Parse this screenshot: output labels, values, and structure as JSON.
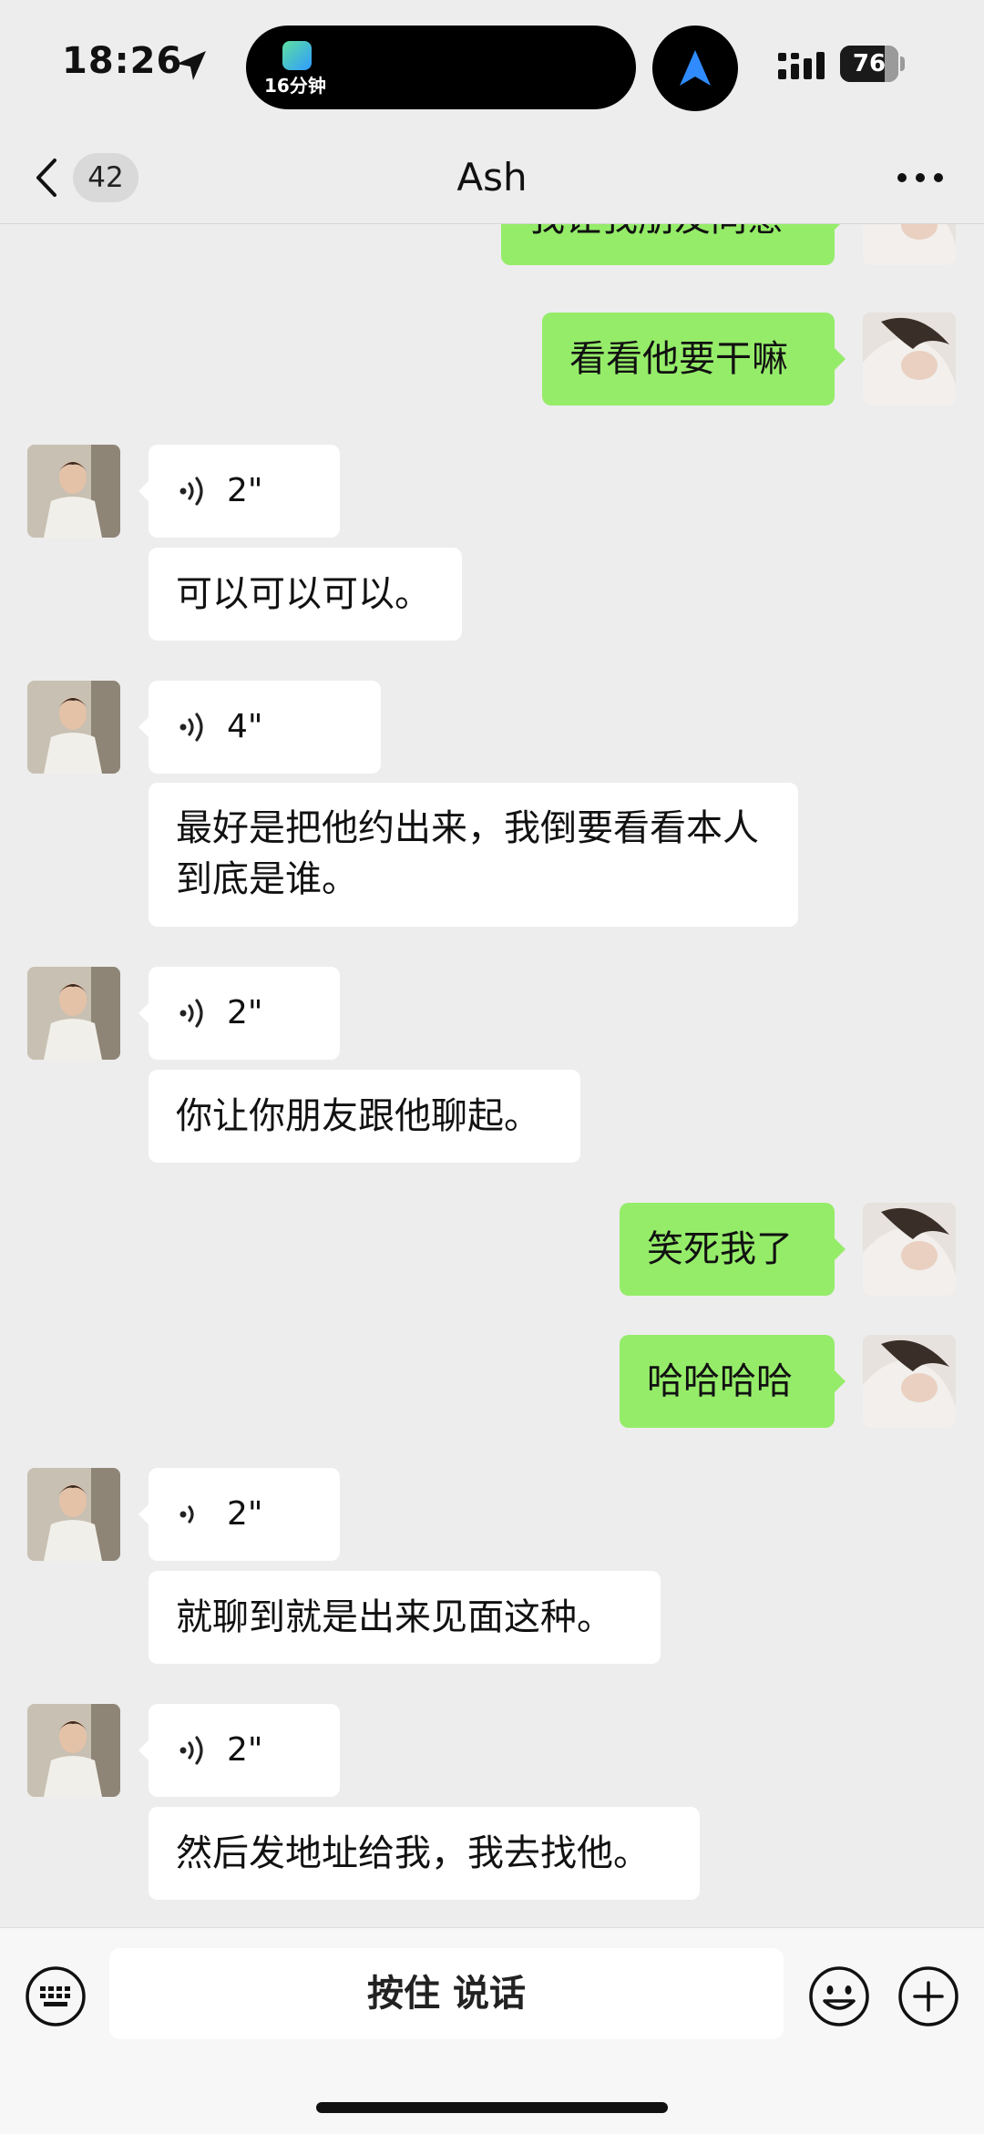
{
  "status_bar": {
    "time": "18:26",
    "island_text": "16分钟",
    "battery": "76",
    "battery_level": 0.76
  },
  "header": {
    "back_badge": "42",
    "title": "Ash"
  },
  "messages": [
    {
      "from": "me",
      "type": "text",
      "text": "我让我朋友同意"
    },
    {
      "from": "me",
      "type": "text",
      "text": "看看他要干嘛"
    },
    {
      "from": "ash",
      "type": "voice",
      "duration": "2\""
    },
    {
      "from": "ash",
      "type": "text",
      "text": "可以可以可以。"
    },
    {
      "from": "ash",
      "type": "voice",
      "duration": "4\""
    },
    {
      "from": "ash",
      "type": "text",
      "text": "最好是把他约出来，我倒要看看本人到底是谁。"
    },
    {
      "from": "ash",
      "type": "voice",
      "duration": "2\""
    },
    {
      "from": "ash",
      "type": "text",
      "text": "你让你朋友跟他聊起。"
    },
    {
      "from": "me",
      "type": "text",
      "text": "笑死我了"
    },
    {
      "from": "me",
      "type": "text",
      "text": "哈哈哈哈"
    },
    {
      "from": "ash",
      "type": "voice",
      "duration": "2\""
    },
    {
      "from": "ash",
      "type": "text",
      "text": "就聊到就是出来见面这种。"
    },
    {
      "from": "ash",
      "type": "voice",
      "duration": "2\""
    },
    {
      "from": "ash",
      "type": "text",
      "text": "然后发地址给我，我去找他。"
    }
  ],
  "input_bar": {
    "hold_to_talk": "按住 说话"
  },
  "colors": {
    "background": "#ededed",
    "outgoing_bubble": "#95ec69",
    "incoming_bubble": "#ffffff"
  },
  "icons": [
    "location-arrow-icon",
    "navigation-icon",
    "signal-icon",
    "back-chevron-icon",
    "more-icon",
    "voice-wave-icon",
    "keyboard-icon",
    "emoji-icon",
    "plus-icon"
  ]
}
